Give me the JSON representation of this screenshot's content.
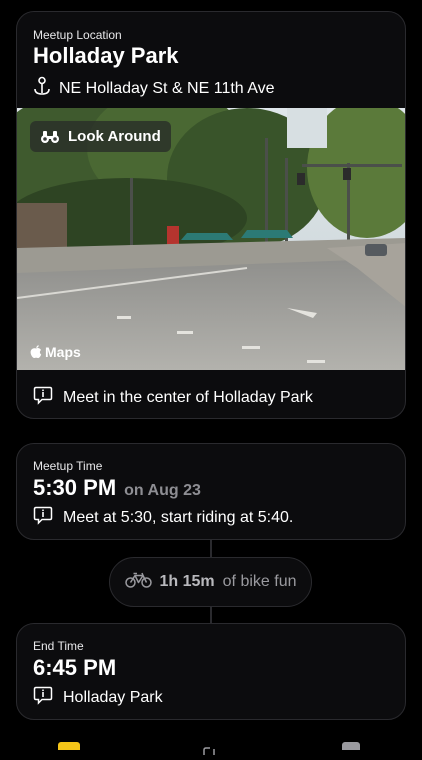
{
  "meetup": {
    "label": "Meetup Location",
    "title": "Holladay Park",
    "address": "NE Holladay St & NE 11th Ave",
    "look_around": "Look Around",
    "maps_label": "Maps",
    "note": "Meet in the center of Holladay Park"
  },
  "meetup_time": {
    "label": "Meetup Time",
    "time": "5:30 PM",
    "date": "on Aug 23",
    "note": "Meet at 5:30, start riding at 5:40."
  },
  "ride": {
    "duration": "1h 15m",
    "suffix": "of bike fun",
    "icon": "bicycle-icon"
  },
  "end": {
    "label": "End Time",
    "time": "6:45 PM",
    "note": "Holladay Park"
  },
  "colors": {
    "background": "#000000",
    "card": "#0c0c0e",
    "border": "#2a2a2e",
    "secondary": "#8e8e93",
    "tab_accent": "#f5c518"
  }
}
